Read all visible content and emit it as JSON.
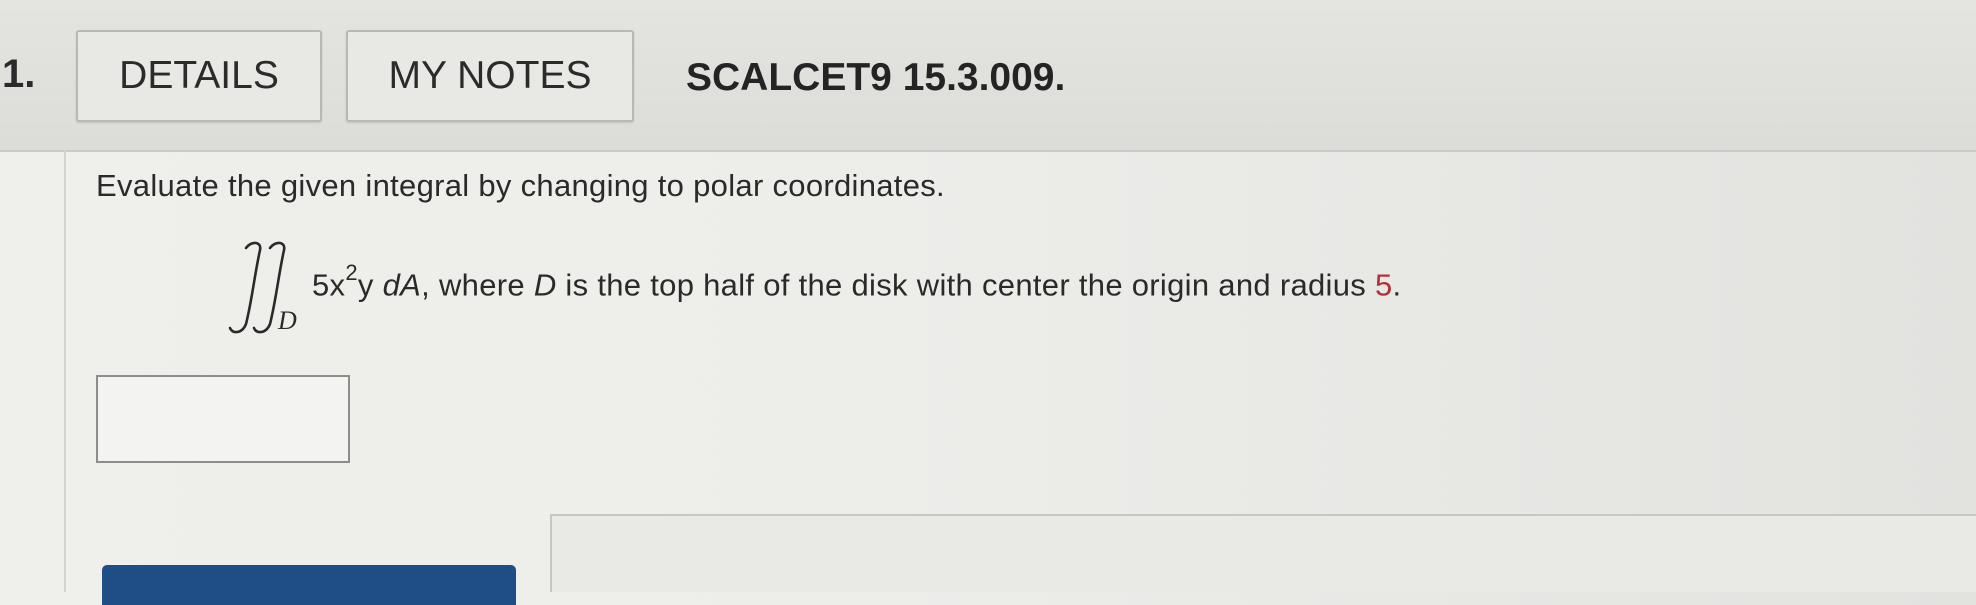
{
  "header": {
    "question_number": "1.",
    "details_label": "DETAILS",
    "notes_label": "MY NOTES",
    "problem_id": "SCALCET9 15.3.009."
  },
  "question": {
    "instruction": "Evaluate the given integral by changing to polar coordinates.",
    "integral_region": "D",
    "integrand_coefficient": "5x",
    "integrand_exponent": "2",
    "integrand_rest": "y",
    "differential": "dA",
    "text_before_region": ", where ",
    "region_var": "D",
    "text_after_region": " is the top half of the disk with center the origin and radius ",
    "radius_value": "5",
    "period": "."
  },
  "answer": {
    "value": ""
  },
  "colors": {
    "highlight_value": "#b3303a",
    "submit_button": "#1f4d86"
  }
}
